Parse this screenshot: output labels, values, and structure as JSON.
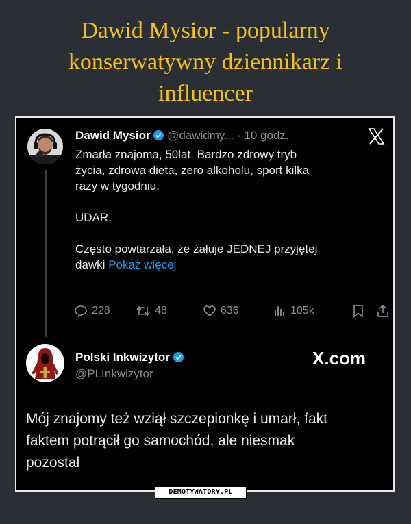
{
  "header": {
    "title_lines": [
      "Dawid Mysior - popularny",
      "konserwatywny dziennikarz i",
      "influencer"
    ]
  },
  "tweet1": {
    "author_name": "Dawid Mysior",
    "handle_time": "@dawidmy... · 10 godz.",
    "body_lines": [
      "Zmarła znajoma, 50lat. Bardzo zdrowy tryb",
      "życia,  zdrowa dieta, zero alkoholu, sport kilka",
      "razy w tygodniu."
    ],
    "body_udar": "UDAR.",
    "body_tail_line1": "Często powtarzała, że żałuje JEDNEJ przyjętej",
    "body_tail_line2": "dawki",
    "show_more": "Pokaż więcej",
    "replies": "228",
    "retweets": "48",
    "likes": "636",
    "views": "105k"
  },
  "tweet2": {
    "author_name": "Polski Inkwizytor",
    "handle": "@PLInkwizytor",
    "source": "X.com",
    "body_lines": [
      "Mój znajomy też wziął szczepionkę i umarł, fakt",
      "faktem potrącił go samochód, ale niesmak",
      "pozostał"
    ]
  },
  "watermark": "DEMOTYWATORY.PL",
  "colors": {
    "background": "#2b2f35",
    "title": "#f2c21b",
    "accent": "#1d9bf0",
    "card": "#000000"
  }
}
